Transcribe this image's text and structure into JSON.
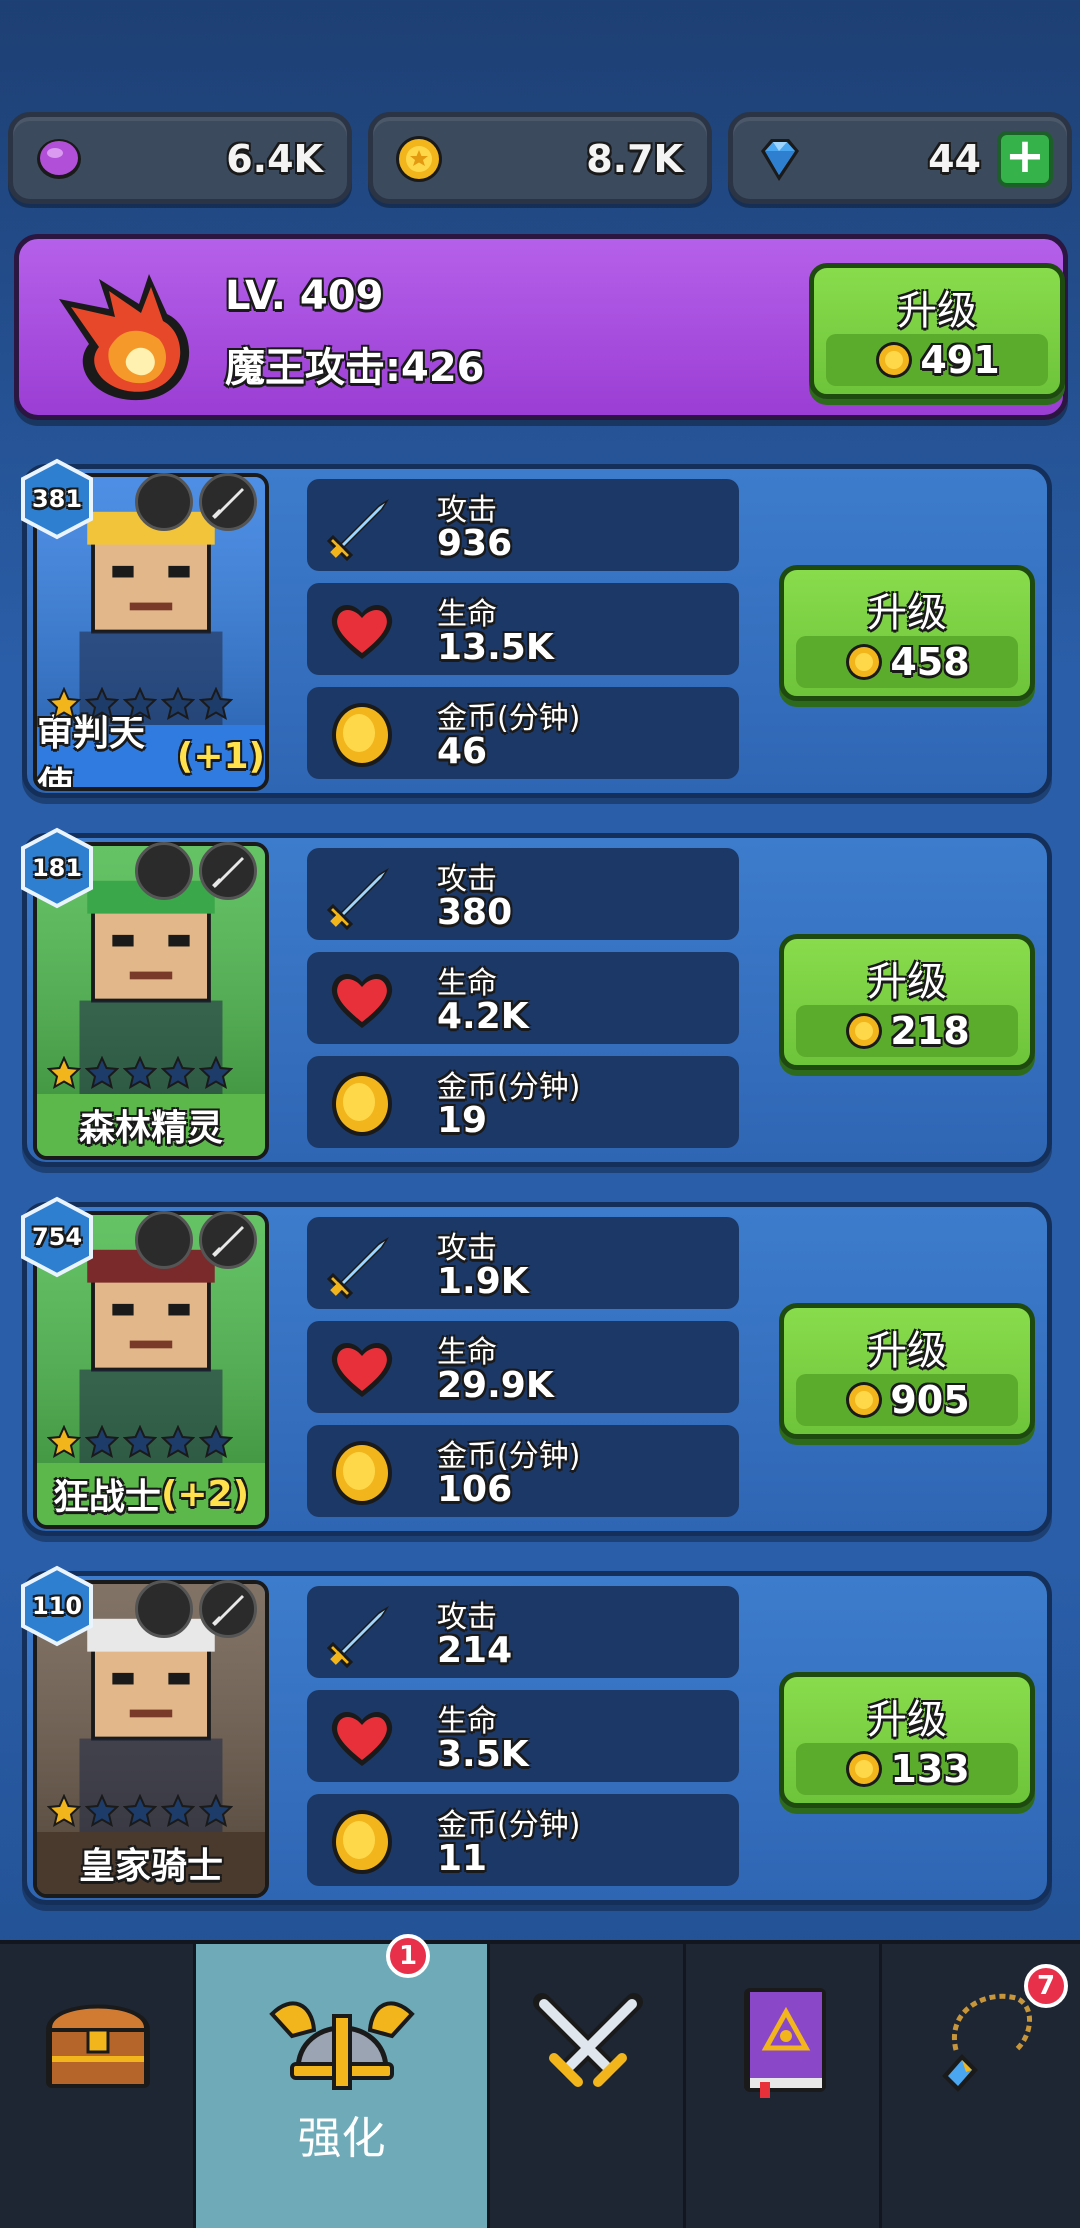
{
  "resources": {
    "purple": {
      "value": "6.4K",
      "icon": "purple-gem-icon"
    },
    "gold": {
      "value": "8.7K",
      "icon": "gold-coin-icon"
    },
    "diamond": {
      "value": "44",
      "icon": "diamond-icon",
      "plus": "+"
    }
  },
  "banner": {
    "level": "LV. 409",
    "attack": "魔王攻击:426",
    "upgrade_label": "升级",
    "upgrade_cost": "491"
  },
  "heroes": [
    {
      "level": "381",
      "name": "审判天使",
      "bonus": "(+1)",
      "attack_label": "攻击",
      "attack": "936",
      "life_label": "生命",
      "life": "13.5K",
      "gold_label": "金币(分钟)",
      "gold": "46",
      "upgrade_label": "升级",
      "cost": "458",
      "stars": 1,
      "card_color": "#2f7be0"
    },
    {
      "level": "181",
      "name": "森林精灵",
      "bonus": "",
      "attack_label": "攻击",
      "attack": "380",
      "life_label": "生命",
      "life": "4.2K",
      "gold_label": "金币(分钟)",
      "gold": "19",
      "upgrade_label": "升级",
      "cost": "218",
      "stars": 1,
      "card_color": "#4ab84a"
    },
    {
      "level": "754",
      "name": "狂战士",
      "bonus": "(+2)",
      "attack_label": "攻击",
      "attack": "1.9K",
      "life_label": "生命",
      "life": "29.9K",
      "gold_label": "金币(分钟)",
      "gold": "106",
      "upgrade_label": "升级",
      "cost": "905",
      "stars": 1,
      "card_color": "#4ab84a"
    },
    {
      "level": "110",
      "name": "皇家骑士",
      "bonus": "",
      "attack_label": "攻击",
      "attack": "214",
      "life_label": "生命",
      "life": "3.5K",
      "gold_label": "金币(分钟)",
      "gold": "11",
      "upgrade_label": "升级",
      "cost": "133",
      "stars": 1,
      "card_color": "#6b5a4a"
    }
  ],
  "nav": {
    "tabs": [
      {
        "icon": "treasure-chest-icon"
      },
      {
        "icon": "winged-helmet-icon",
        "label": "强化",
        "badge": "1"
      },
      {
        "icon": "crossed-swords-icon"
      },
      {
        "icon": "spellbook-icon"
      },
      {
        "icon": "amulet-icon",
        "badge": "7"
      }
    ]
  },
  "colors": {
    "accent_green": "#6ec43a",
    "banner_purple": "#9b3ed4",
    "panel_blue": "#2f66b4"
  }
}
